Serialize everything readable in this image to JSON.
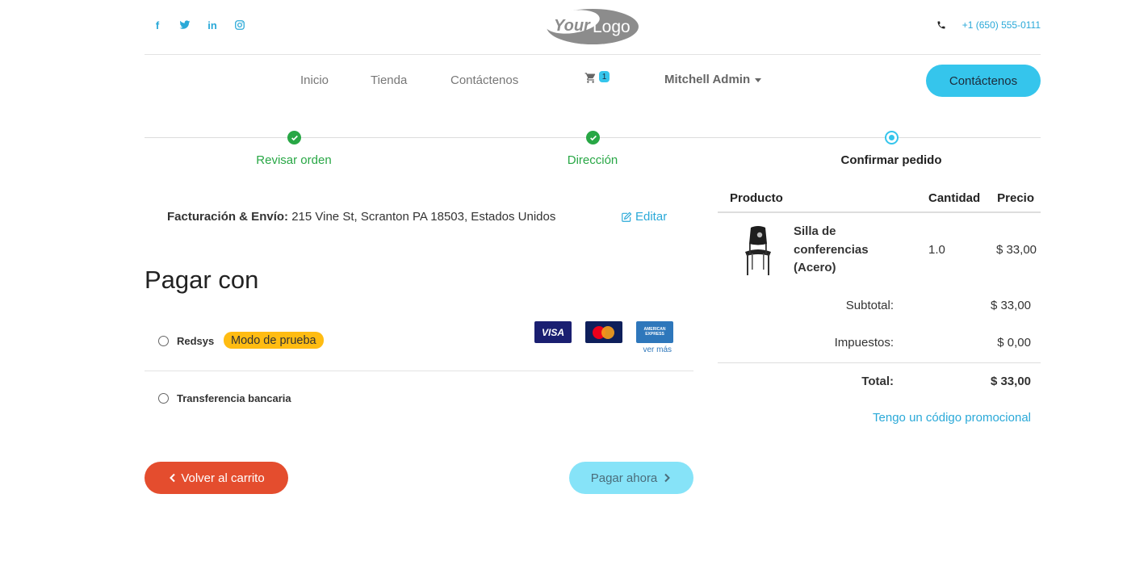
{
  "header": {
    "social": [
      {
        "icon": "facebook-icon",
        "glyph": "f"
      },
      {
        "icon": "twitter-icon",
        "glyph": "t"
      },
      {
        "icon": "linkedin-icon",
        "glyph": "in"
      },
      {
        "icon": "instagram-icon",
        "glyph": "◎"
      }
    ],
    "logo_text_your": "Your",
    "logo_text_logo": "Logo",
    "phone": "+1 (650) 555-0111"
  },
  "nav": {
    "items": [
      "Inicio",
      "Tienda",
      "Contáctenos"
    ],
    "cart_count": "1",
    "user": "Mitchell Admin",
    "contact_button": "Contáctenos"
  },
  "steps": [
    {
      "label": "Revisar orden",
      "state": "done"
    },
    {
      "label": "Dirección",
      "state": "done"
    },
    {
      "label": "Confirmar pedido",
      "state": "current"
    }
  ],
  "billing": {
    "label": "Facturación & Envío:",
    "address": "215 Vine St, Scranton PA 18503, Estados Unidos",
    "edit": "Editar"
  },
  "payment": {
    "title": "Pagar con",
    "methods": [
      {
        "name": "Redsys",
        "badge": "Modo de prueba"
      },
      {
        "name": "Transferencia bancaria"
      }
    ],
    "cards": {
      "visa": "VISA",
      "mastercard": "MasterCard",
      "amex_line1": "AMERICAN",
      "amex_line2": "EXPRESS",
      "see_more": "ver más"
    }
  },
  "actions": {
    "back": "Volver al carrito",
    "pay": "Pagar ahora"
  },
  "summary": {
    "headers": {
      "product": "Producto",
      "qty": "Cantidad",
      "price": "Precio"
    },
    "product": {
      "name": "Silla de conferencias (Acero)",
      "qty": "1.0",
      "price": "$ 33,00"
    },
    "subtotal_label": "Subtotal:",
    "subtotal": "$ 33,00",
    "taxes_label": "Impuestos:",
    "taxes": "$ 0,00",
    "total_label": "Total:",
    "total": "$ 33,00",
    "promo": "Tengo un código promocional"
  },
  "colors": {
    "accent": "#35c5ec",
    "link": "#2aa9d8",
    "success": "#28a745",
    "danger": "#e44d2e",
    "badge": "#ffbc12"
  }
}
